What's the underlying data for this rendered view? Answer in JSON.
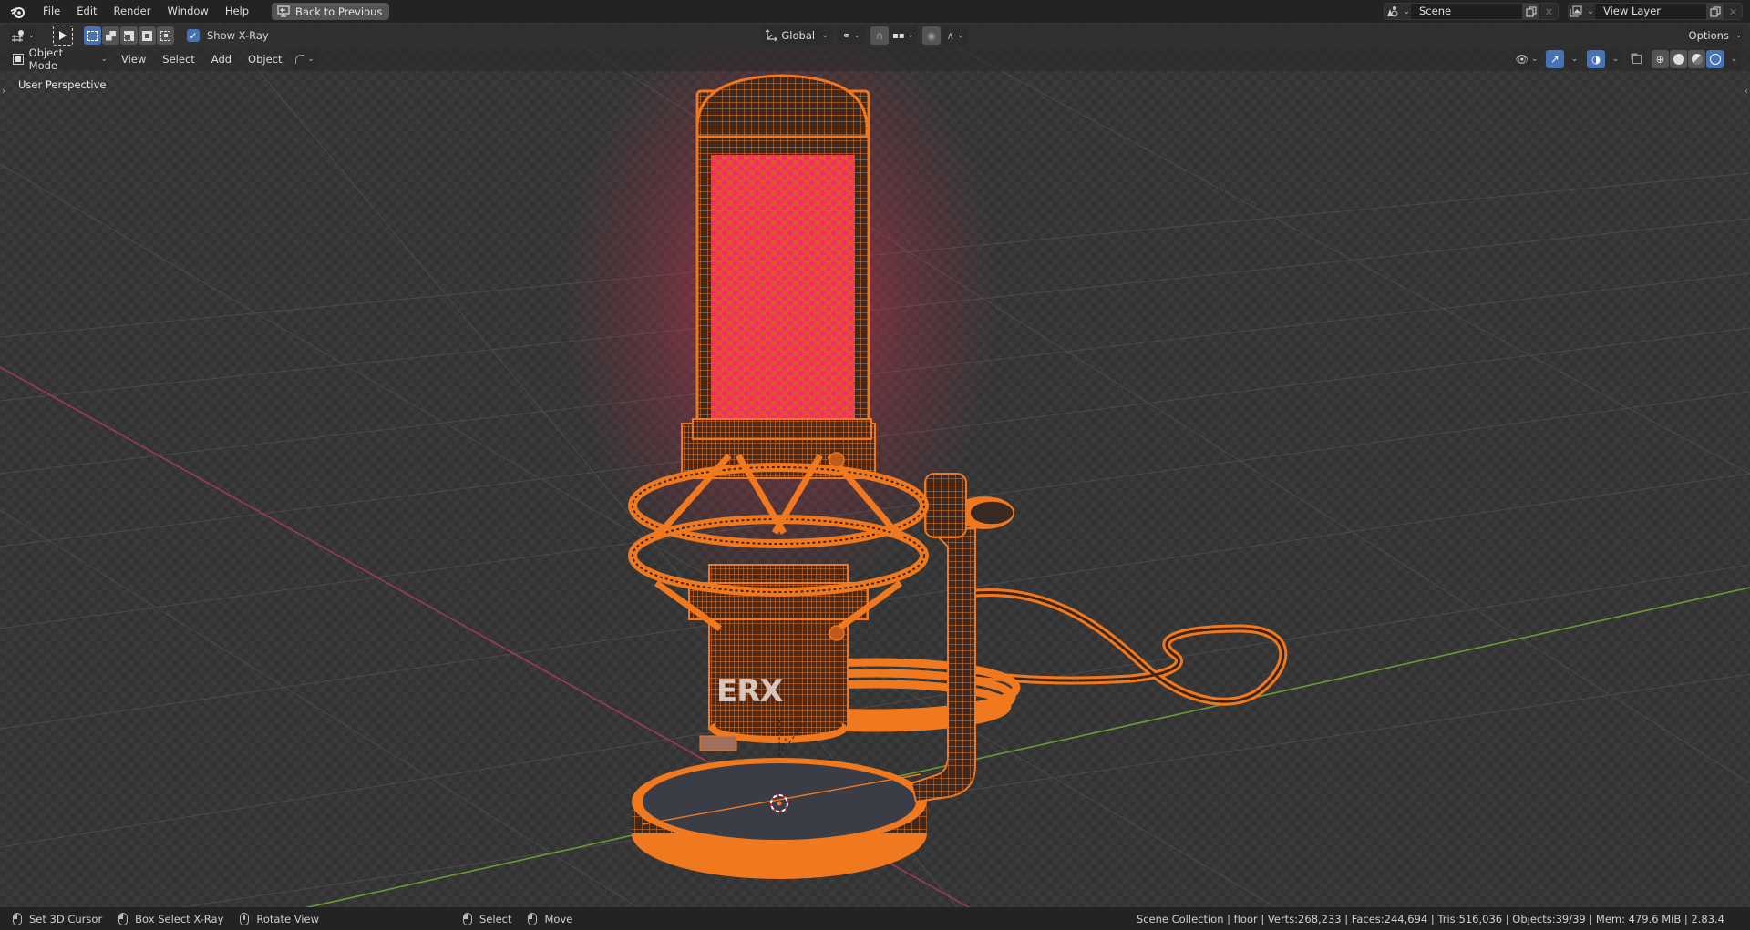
{
  "app": {
    "menu": [
      "File",
      "Edit",
      "Render",
      "Window",
      "Help"
    ],
    "back_button": "Back to Previous",
    "scene": {
      "label": "Scene"
    },
    "view_layer": {
      "label": "View Layer"
    }
  },
  "tool_header": {
    "show_xray_label": "Show X-Ray",
    "show_xray_checked": true,
    "transform_orientation": "Global",
    "options_label": "Options",
    "select_modes": [
      "set",
      "extend",
      "subtract",
      "invert",
      "intersect"
    ],
    "active_select_mode": "set"
  },
  "view_header": {
    "mode": "Object Mode",
    "menus": [
      "View",
      "Select",
      "Add",
      "Object"
    ],
    "shading_modes": [
      "wireframe",
      "solid",
      "material-preview",
      "rendered"
    ],
    "active_shading": "rendered"
  },
  "viewport": {
    "label": "User Perspective",
    "object_outline_color": "#f0781f",
    "grille_glow_color": "#ff2d6a",
    "x_axis_color": "#9c3c4e",
    "y_axis_color": "#6a9a32",
    "microphone_logo_text": "ERX"
  },
  "statusbar": {
    "hints": [
      {
        "icon": "mouse-left-icon",
        "label": "Set 3D Cursor"
      },
      {
        "icon": "mouse-drag-icon",
        "label": "Box Select X-Ray"
      },
      {
        "icon": "mouse-middle-icon",
        "label": "Rotate View"
      },
      {
        "icon": "mouse-left-icon",
        "label": "Select"
      },
      {
        "icon": "mouse-drag-icon",
        "label": "Move"
      }
    ],
    "stats": "Scene Collection | floor | Verts:268,233 | Faces:244,694 | Tris:516,036 | Objects:39/39 | Mem: 479.6 MiB | 2.83.4"
  }
}
